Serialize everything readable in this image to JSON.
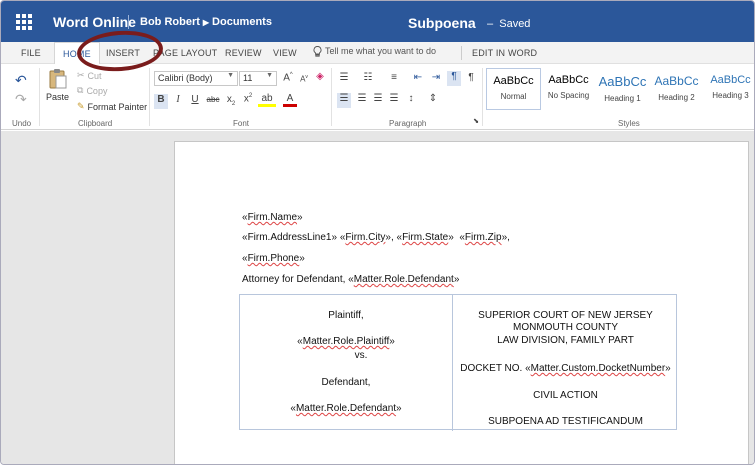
{
  "app": {
    "name": "Word Online",
    "user": "Bob Robert",
    "folder": "Documents",
    "doc_title": "Subpoena",
    "status": "Saved"
  },
  "tabs": [
    "FILE",
    "HOME",
    "INSERT",
    "PAGE LAYOUT",
    "REVIEW",
    "VIEW"
  ],
  "tell_me": "Tell me what you want to do",
  "edit_in_word": "EDIT IN WORD",
  "ribbon": {
    "undo_label": "Undo",
    "clipboard": {
      "paste": "Paste",
      "cut": "Cut",
      "copy": "Copy",
      "format_painter": "Format Painter",
      "label": "Clipboard"
    },
    "font": {
      "name": "Calibri (Body)",
      "size": "11",
      "label": "Font"
    },
    "paragraph_label": "Paragraph",
    "styles_label": "Styles",
    "styles": [
      {
        "sample": "AaBbCc",
        "name": "Normal"
      },
      {
        "sample": "AaBbCc",
        "name": "No Spacing"
      },
      {
        "sample": "AaBbCc",
        "name": "Heading 1"
      },
      {
        "sample": "AaBbCc",
        "name": "Heading 2"
      },
      {
        "sample": "AaBbCc",
        "name": "Heading 3"
      }
    ]
  },
  "document": {
    "firm_name": "Firm.Name",
    "address_line1": "Firm.AddressLine1",
    "city": "Firm.City",
    "state": "Firm.State",
    "zip": "Firm.Zip",
    "phone": "Firm.Phone",
    "attorney_prefix": "Attorney for Defendant,",
    "defendant_field": "Matter.Role.Defendant",
    "plaintiff_label": "Plaintiff,",
    "plaintiff_field": "Matter.Role.Plaintiff",
    "vs": "vs.",
    "defendant_label": "Defendant,",
    "court_line1": "SUPERIOR COURT OF NEW JERSEY",
    "court_line2": "MONMOUTH COUNTY",
    "court_line3": "LAW DIVISION, FAMILY PART",
    "docket_prefix": "DOCKET NO.",
    "docket_field": "Matter.Custom.DocketNumber",
    "civil_action": "CIVIL ACTION",
    "subpoena_type": "SUBPOENA AD TESTIFICANDUM"
  },
  "colors": {
    "brand": "#2b579a",
    "annotation_oval": "#7a1c1c",
    "heading_style": "#2e74b5"
  }
}
